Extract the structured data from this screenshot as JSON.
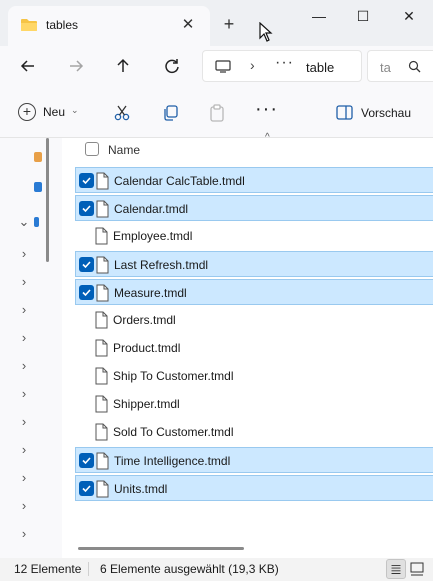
{
  "window": {
    "tab_title": "tables",
    "tab_close": "✕",
    "new_tab": "+",
    "minimize": "—",
    "maximize": "☐",
    "close": "✕"
  },
  "address": {
    "breadcrumb_sep": "›",
    "breadcrumb_more": "···",
    "breadcrumb_current": "table",
    "search_placeholder": "ta"
  },
  "commands": {
    "new_label": "Neu",
    "new_chevron": "⌄",
    "more": "···",
    "preview_label": "Vorschau"
  },
  "filelist": {
    "sort_caret": "^",
    "name_header": "Name",
    "rows": [
      {
        "name": "Calendar CalcTable.tmdl",
        "selected": true
      },
      {
        "name": "Calendar.tmdl",
        "selected": true
      },
      {
        "name": "Employee.tmdl",
        "selected": false
      },
      {
        "name": "Last Refresh.tmdl",
        "selected": true
      },
      {
        "name": "Measure.tmdl",
        "selected": true
      },
      {
        "name": "Orders.tmdl",
        "selected": false
      },
      {
        "name": "Product.tmdl",
        "selected": false
      },
      {
        "name": "Ship To Customer.tmdl",
        "selected": false
      },
      {
        "name": "Shipper.tmdl",
        "selected": false
      },
      {
        "name": "Sold To Customer.tmdl",
        "selected": false
      },
      {
        "name": "Time Intelligence.tmdl",
        "selected": true
      },
      {
        "name": "Units.tmdl",
        "selected": true
      }
    ]
  },
  "navpane": {
    "expand_chevron": "›",
    "expanded_chevron": "⌄"
  },
  "status": {
    "item_count": "12 Elemente",
    "selection": "6 Elemente ausgewählt (19,3 KB)"
  },
  "colors": {
    "selection_bg": "#cce8ff",
    "selection_border": "#99c9ef",
    "checkbox_accent": "#005fb8",
    "folder_yellow": "#f6c445"
  }
}
